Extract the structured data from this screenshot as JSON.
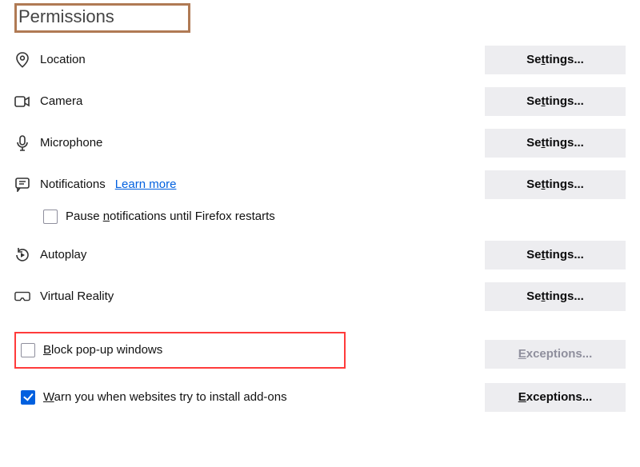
{
  "heading": "Permissions",
  "rows": {
    "location": {
      "label": "Location",
      "button": "Se<u>t</u>tings..."
    },
    "camera": {
      "label": "Camera",
      "button": "Se<u>t</u>tings..."
    },
    "microphone": {
      "label": "Microphone",
      "button": "Se<u>t</u>tings..."
    },
    "notifications": {
      "label": "Notifications",
      "link": "Learn more",
      "button": "Se<u>t</u>tings..."
    },
    "pause_notifications": {
      "label_pre": "Pause ",
      "label_key": "n",
      "label_post": "otifications until Firefox restarts",
      "checked": false
    },
    "autoplay": {
      "label": "Autoplay",
      "button": "Se<u>t</u>tings..."
    },
    "vr": {
      "label": "Virtual Reality",
      "button": "Se<u>t</u>tings..."
    },
    "block_popups": {
      "label_pre": "",
      "label_key": "B",
      "label_post": "lock pop-up windows",
      "checked": false,
      "button": "<u>E</u>xceptions..."
    },
    "warn_addons": {
      "label_pre": "",
      "label_key": "W",
      "label_post": "arn you when websites try to install add-ons",
      "checked": true,
      "button": "<u>E</u>xceptions..."
    }
  }
}
